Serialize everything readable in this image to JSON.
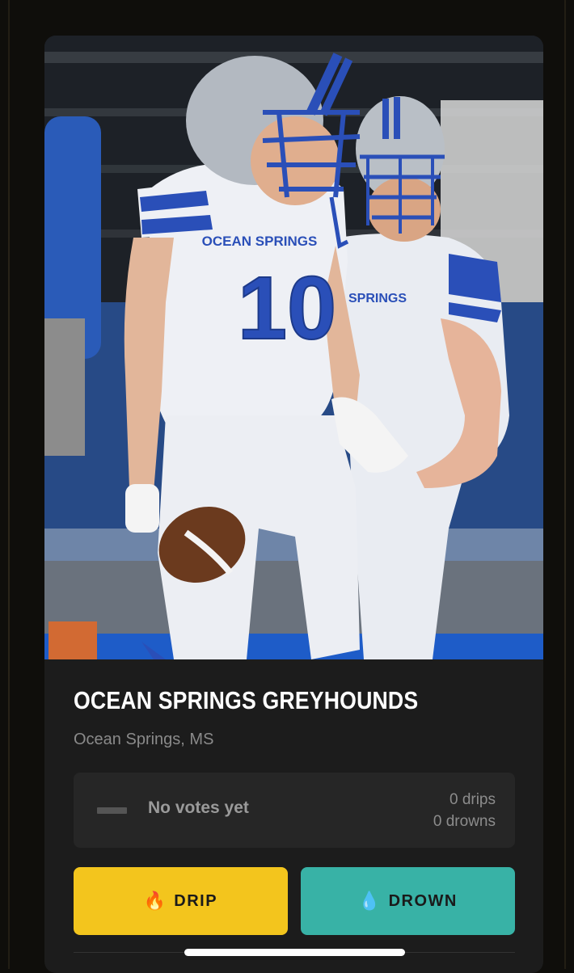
{
  "team": {
    "name": "OCEAN SPRINGS GREYHOUNDS",
    "location": "Ocean Springs, MS"
  },
  "votes": {
    "status": "No votes yet",
    "drips": "0 drips",
    "drowns": "0 drowns"
  },
  "actions": {
    "drip_emoji": "🔥",
    "drip_label": "DRIP",
    "drown_emoji": "💧",
    "drown_label": "DROWN"
  },
  "photo": {
    "jersey_front_text": "OCEAN SPRINGS",
    "jersey_number": "10",
    "jersey_right_text": "N SPRINGS"
  },
  "colors": {
    "drip": "#f3c51d",
    "drown": "#38b2a6",
    "card": "#1c1c1c",
    "jersey_blue": "#2a4fb8"
  }
}
